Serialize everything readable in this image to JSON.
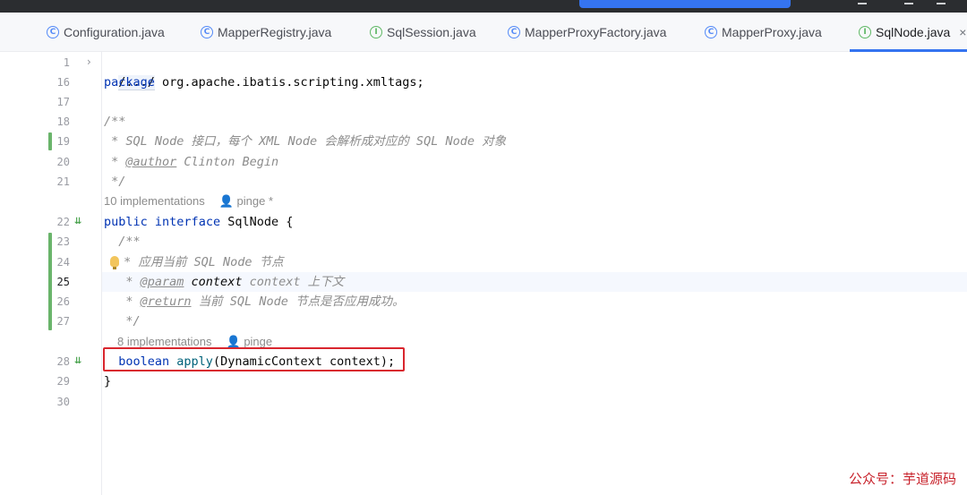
{
  "tabs": [
    {
      "label": "Configuration.java",
      "icon": "class-icon",
      "active": false
    },
    {
      "label": "MapperRegistry.java",
      "icon": "class-icon",
      "active": false
    },
    {
      "label": "SqlSession.java",
      "icon": "interface-icon",
      "active": false
    },
    {
      "label": "MapperProxyFactory.java",
      "icon": "class-icon",
      "active": false
    },
    {
      "label": "MapperProxy.java",
      "icon": "class-icon",
      "active": false
    },
    {
      "label": "SqlNode.java",
      "icon": "interface-icon",
      "active": true
    }
  ],
  "tab_icon_letters": {
    "class": "C",
    "interface": "I"
  },
  "tab_close": "×",
  "line_numbers": [
    "1",
    "16",
    "17",
    "18",
    "19",
    "20",
    "21",
    "22",
    "23",
    "24",
    "25",
    "26",
    "27",
    "28",
    "29",
    "30"
  ],
  "current_line": "25",
  "code": {
    "l1_fold": "/.../",
    "l16_kw": "package",
    "l16_rest": " org.apache.ibatis.scripting.xmltags;",
    "l18": "/**",
    "l19": " * SQL Node 接口，每个 XML Node 会解析成对应的 SQL Node 对象",
    "l20_pre": " * ",
    "l20_tag": "@author",
    "l20_post": " Clinton Begin",
    "l21": " */",
    "l22_kw1": "public",
    "l22_kw2": "interface",
    "l22_rest": " SqlNode {",
    "l23": "  /**",
    "l24": " * 应用当前 SQL Node 节点",
    "l25_pre": "   * ",
    "l25_tag": "@param",
    "l25_name": " context",
    "l25_post": " context 上下文",
    "l26_pre": "   * ",
    "l26_tag": "@return",
    "l26_post": " 当前 SQL Node 节点是否应用成功。",
    "l27": "   */",
    "l28_kw": "  boolean",
    "l28_fn": " apply",
    "l28_rest": "(DynamicContext context);",
    "l29": "}"
  },
  "hints": {
    "interface_impls": "10 implementations",
    "interface_author": "pinge *",
    "method_impls": "8 implementations",
    "method_author": "pinge"
  },
  "gutter_marks": {
    "implemented": "⇊",
    "fold": "›"
  },
  "watermark": "公众号：芋道源码",
  "colors": {
    "accent": "#3574f0",
    "highlight_box": "#d9262e",
    "vcs_added": "#6ab46b"
  }
}
